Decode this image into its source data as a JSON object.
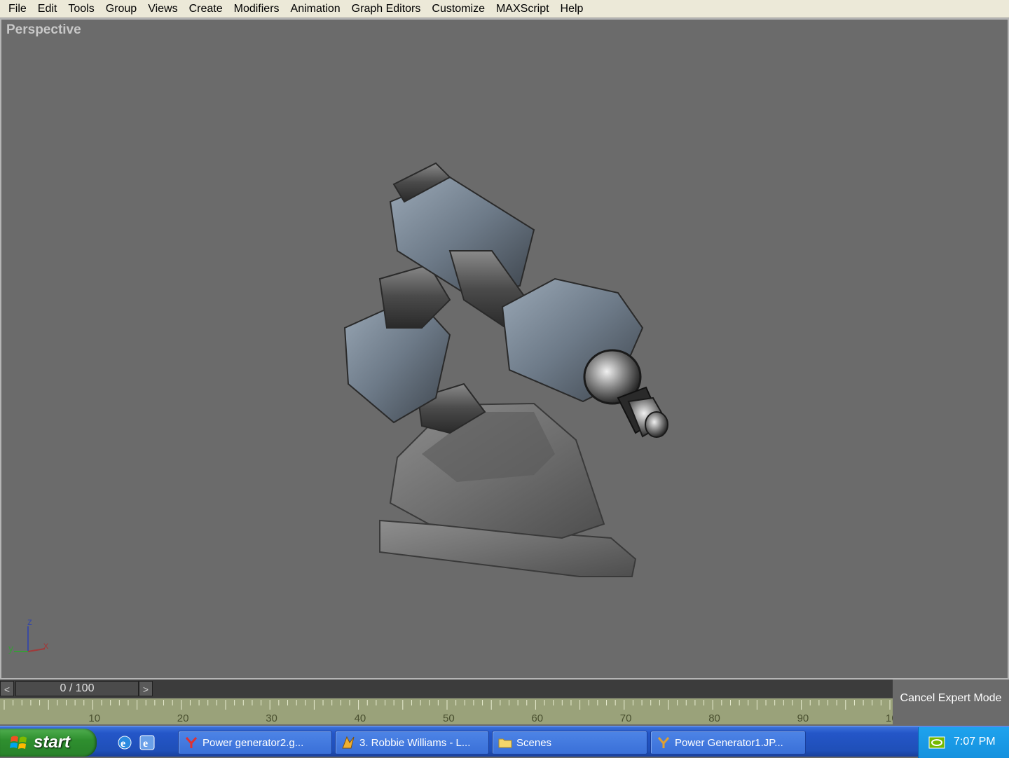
{
  "menubar": {
    "items": [
      "File",
      "Edit",
      "Tools",
      "Group",
      "Views",
      "Create",
      "Modifiers",
      "Animation",
      "Graph Editors",
      "Customize",
      "MAXScript",
      "Help"
    ]
  },
  "viewport": {
    "label": "Perspective",
    "axis": {
      "z": "z",
      "y": "y",
      "x": "x"
    }
  },
  "timeline": {
    "prev_label": "<",
    "next_label": ">",
    "slider_text": "0 / 100",
    "ticks": [
      "10",
      "20",
      "30",
      "40",
      "50",
      "60",
      "70",
      "80",
      "90",
      "10"
    ]
  },
  "expert_mode": {
    "cancel_label": "Cancel Expert Mode"
  },
  "taskbar": {
    "start_label": "start",
    "tasks": [
      {
        "label": "Power generator2.g...",
        "icon": "y-app-icon"
      },
      {
        "label": "3. Robbie Williams - L...",
        "icon": "winamp-icon"
      },
      {
        "label": "Scenes",
        "icon": "folder-icon"
      },
      {
        "label": "Power Generator1.JP...",
        "icon": "image-viewer-icon"
      }
    ],
    "clock": "7:07 PM"
  },
  "colors": {
    "viewport_bg": "#6b6b6b",
    "trackbar_bg": "#9aa27a",
    "taskbar_blue": "#2456c8",
    "start_green": "#2f8f2f"
  }
}
